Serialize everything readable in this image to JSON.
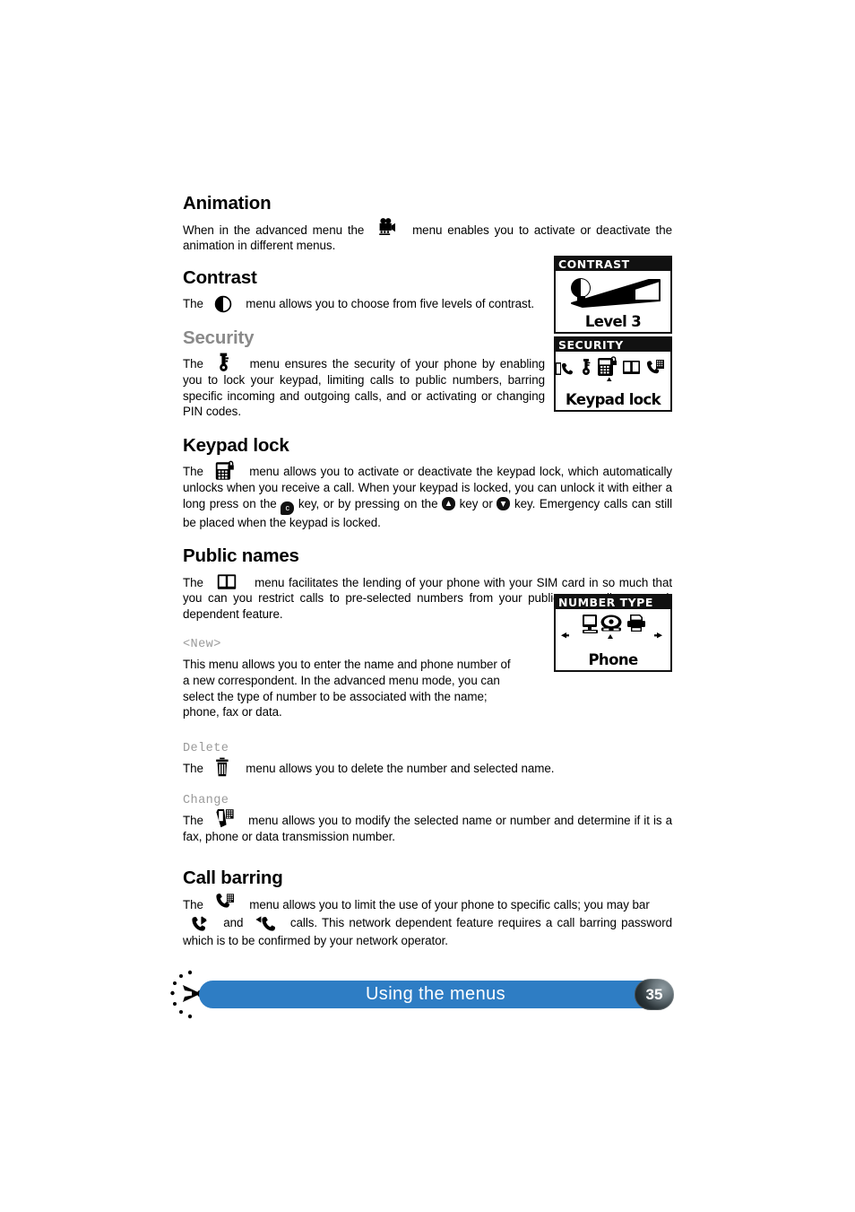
{
  "document": {
    "page_number": "35",
    "footer_title": "Using the menus"
  },
  "sections": [
    {
      "id": "animation",
      "heading": "Animation",
      "heading_color": "#000000",
      "icon": "movie-camera-icon",
      "text_before_icon": "When in the advanced menu the",
      "text_after_icon": "menu enables you to activate or deactivate the animation in different menus."
    },
    {
      "id": "contrast",
      "heading": "Contrast",
      "heading_color": "#000000",
      "icon": "contrast-half-circle-icon",
      "text_before_icon": "The",
      "text_after_icon": "menu allows you to choose from five levels of contrast."
    },
    {
      "id": "security",
      "heading": "Security",
      "heading_color": "#8a8a8a",
      "icon": "key-icon",
      "text_before_icon": "The",
      "text_after_icon": "menu ensures the security of your phone by enabling you to lock your keypad, limiting calls to public numbers, barring specific incoming and outgoing calls, and or activating or changing PIN codes."
    },
    {
      "id": "keypad-lock",
      "heading": "Keypad lock",
      "heading_color": "#000000",
      "icon": "phone-keypad-lock-icon",
      "text_before_icon": "The",
      "text_part_1": "menu allows you to activate or deactivate the keypad lock, which automatically unlocks when you receive a call.  When your keypad is locked, you can unlock it with either a long press on the",
      "key_c": "c",
      "text_part_2": "key, or by pressing on the",
      "text_part_3": "key or",
      "text_part_4": "key.  Emergency calls can still be placed when the keypad is locked."
    },
    {
      "id": "public-names",
      "heading": "Public names",
      "heading_color": "#000000",
      "icon": "open-book-icon",
      "text_before_icon": "The",
      "text_after_icon": "menu facilitates the lending of your phone with your SIM card in so much that you can you restrict calls to pre-selected numbers from your public names list; network dependent feature."
    }
  ],
  "subsections": [
    {
      "id": "new",
      "label": "<New>",
      "text": "This menu allows you to enter the name and phone number of a new correspondent.  In the advanced menu mode, you can select the type of number to be associated with the name; phone, fax or data."
    },
    {
      "id": "delete",
      "label": "Delete",
      "icon": "trash-can-icon",
      "text_before_icon": "The",
      "text_after_icon": "menu allows you to delete the number and selected name."
    },
    {
      "id": "change",
      "label": "Change",
      "icon": "edit-phone-icon",
      "text_before_icon": "The",
      "text_after_icon": "menu allows you to modify the selected name or number and determine if it is a fax, phone or data transmission number."
    }
  ],
  "call_barring": {
    "heading": "Call barring",
    "heading_color": "#000000",
    "icon": "call-barring-icon",
    "text_before_icon": "The",
    "text_part_1": "menu allows you to limit the use of your phone to specific calls; you may bar",
    "icon_incoming": "incoming-call-icon",
    "text_and": "and",
    "icon_outgoing": "outgoing-call-icon",
    "text_part_2": "calls.  This network dependent feature requires a call barring password which is to be confirmed by your network operator."
  },
  "lcd_screens": [
    {
      "id": "contrast-screen",
      "title": "CONTRAST",
      "label": "Level 3",
      "graphic": "contrast-wedge-graphic"
    },
    {
      "id": "security-screen",
      "title": "SECURITY",
      "label": "Keypad lock",
      "graphic": "security-menu-icons"
    },
    {
      "id": "number-type-screen",
      "title": "NUMBER TYPE",
      "label": "Phone",
      "graphic": "number-type-icons"
    }
  ],
  "colors": {
    "footer_blue": "#2e7dc4",
    "gray_heading": "#8a8a8a",
    "subhead_gray": "#9a9a9a"
  }
}
